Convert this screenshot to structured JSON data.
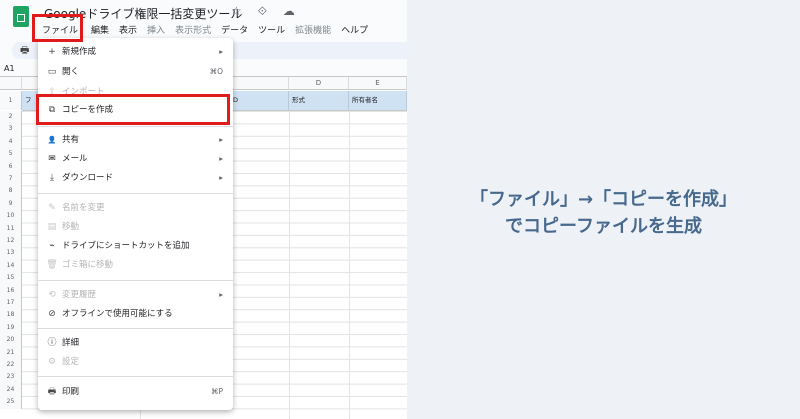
{
  "window": {
    "doc_title": "Googleドライブ権限一括変更ツール",
    "title_icons": "☆ ⟐ ☁"
  },
  "menubar": {
    "items": [
      "ファイル",
      "編集",
      "表示",
      "挿入",
      "表示形式",
      "データ",
      "ツール",
      "拡張機能",
      "ヘルプ"
    ]
  },
  "toolbar": {
    "print_icon": "🖶"
  },
  "namebox": "A1",
  "sheet": {
    "columns": [
      "C",
      "D",
      "E"
    ],
    "row1": {
      "b_tail": "D",
      "d": "形式",
      "e": "所有者名",
      "a_head": "フ"
    },
    "row_numbers": [
      "1",
      "2",
      "3",
      "4",
      "5",
      "6",
      "7",
      "8",
      "9",
      "10",
      "11",
      "12",
      "13",
      "14",
      "15",
      "16",
      "17",
      "18",
      "19",
      "20",
      "21",
      "22",
      "23",
      "24",
      "25"
    ]
  },
  "file_menu": {
    "new": {
      "label": "新規作成",
      "icon": "+"
    },
    "open": {
      "label": "開く",
      "shortcut": "⌘O",
      "icon": "▭"
    },
    "import": {
      "label": "インポート",
      "icon": "⇪"
    },
    "copy": {
      "label": "コピーを作成",
      "icon": "⧉"
    },
    "share": {
      "label": "共有",
      "icon": "👤+"
    },
    "email": {
      "label": "メール",
      "icon": "✉"
    },
    "download": {
      "label": "ダウンロード",
      "icon": "⤓"
    },
    "rename": {
      "label": "名前を変更",
      "icon": "✎"
    },
    "move": {
      "label": "移動",
      "icon": "▤"
    },
    "shortcut": {
      "label": "ドライブにショートカットを追加",
      "icon": "⌁"
    },
    "trash": {
      "label": "ゴミ箱に移動",
      "icon": "🗑"
    },
    "history": {
      "label": "変更履歴",
      "icon": "⟲"
    },
    "offline": {
      "label": "オフラインで使用可能にする",
      "icon": "⊘"
    },
    "details": {
      "label": "詳細",
      "icon": "ⓘ"
    },
    "settings": {
      "label": "設定",
      "icon": "⚙"
    },
    "print": {
      "label": "印刷",
      "shortcut": "⌘P",
      "icon": "🖶"
    },
    "arrow": "▸"
  },
  "caption": {
    "line1": "「ファイル」→「コピーを作成」",
    "line2": "でコピーファイルを生成"
  },
  "colors": {
    "highlight": "#e01b1b",
    "caption": "#47698e",
    "sheets_green": "#1fa463"
  }
}
